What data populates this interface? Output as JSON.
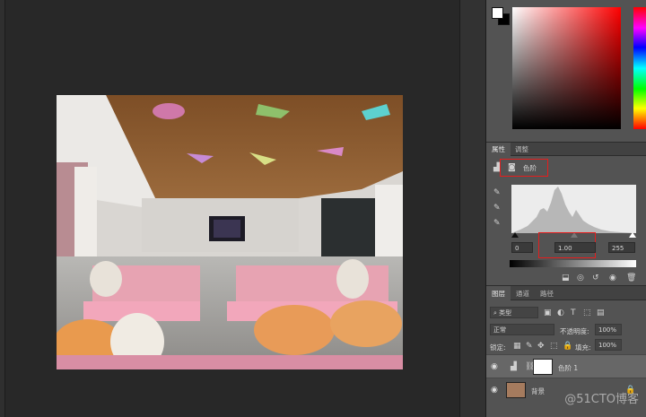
{
  "properties_panel": {
    "tabs": [
      "属性",
      "调整"
    ],
    "adjustment_name": "色阶",
    "input_black": "0",
    "input_gamma": "1.00",
    "input_white": "255"
  },
  "layers_panel": {
    "tabs": [
      "图层",
      "通道",
      "路径"
    ],
    "filter_kind": "类型",
    "blend_mode": "正常",
    "opacity_label": "不透明度:",
    "opacity_value": "100%",
    "lock_label": "锁定:",
    "fill_label": "填充:",
    "fill_value": "100%",
    "layers": [
      {
        "name": "色阶 1",
        "type": "adjustment"
      },
      {
        "name": "背景",
        "type": "background"
      }
    ]
  },
  "watermark": "@51CTO博客",
  "colors": {
    "app_bg": "#282828",
    "panel_bg": "#535353",
    "highlight_box": "#e51d1d",
    "picker_hue": "#ff0000"
  },
  "icons": [
    "eyedropper-black-icon",
    "eyedropper-gray-icon",
    "eyedropper-white-icon",
    "eye-icon",
    "lock-icon",
    "link-icon",
    "trash-icon",
    "histogram-icon",
    "mask-icon"
  ]
}
